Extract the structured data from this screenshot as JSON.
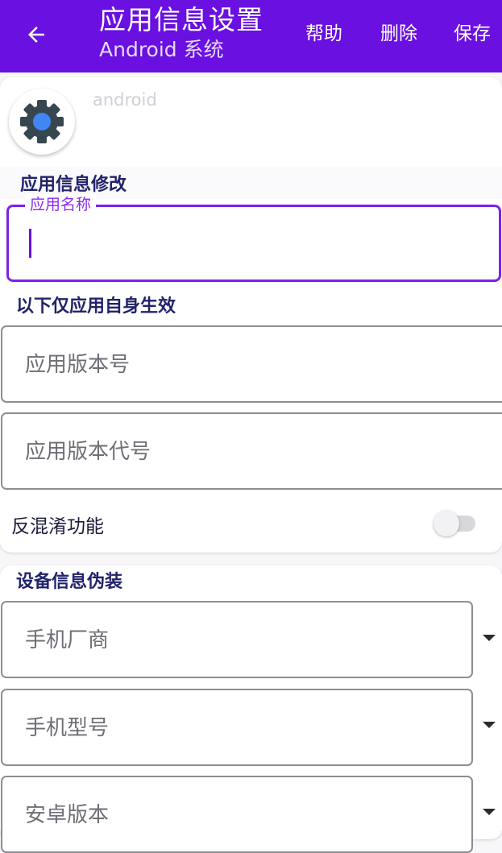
{
  "appbar": {
    "title": "应用信息设置",
    "subtitle": "Android 系统",
    "back_icon": "arrow-left-icon",
    "actions": {
      "help": "帮助",
      "delete": "删除",
      "save": "保存"
    },
    "color": "#6a10e0"
  },
  "app": {
    "icon": "settings-gear-icon",
    "package_name": "android"
  },
  "edit_section": {
    "title": "应用信息修改",
    "app_name_label": "应用名称",
    "app_name_value": ""
  },
  "self_section": {
    "title": "以下仅应用自身生效",
    "version_name_placeholder": "应用版本号",
    "version_code_placeholder": "应用版本代号",
    "anti_obfuscation_label": "反混淆功能",
    "anti_obfuscation_on": false
  },
  "device_section": {
    "title": "设备信息伪装",
    "manufacturer_placeholder": "手机厂商",
    "model_placeholder": "手机型号",
    "android_version_placeholder": "安卓版本",
    "dropdown_icon": "caret-down-icon"
  }
}
